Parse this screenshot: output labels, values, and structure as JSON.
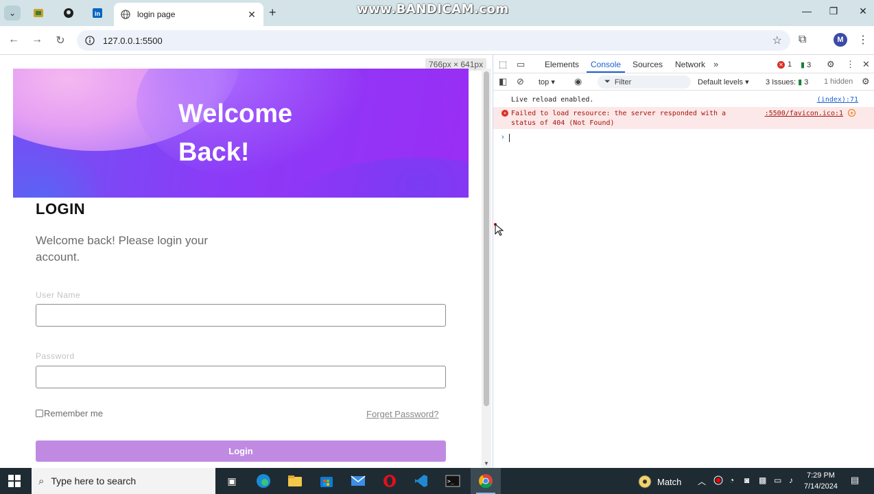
{
  "browser": {
    "tab_title": "login page",
    "url": "127.0.0.1:5500",
    "watermark": "www.BANDICAM.com",
    "profile_initial": "M",
    "viewport_size": "766px × 641px"
  },
  "page": {
    "hero_title": "Welcome Back!",
    "login_heading": "LOGIN",
    "subtitle": "Welcome back! Please login your account.",
    "username_label": "User Name",
    "password_label": "Password",
    "remember_label": "Remember me",
    "forgot_label": "Forget Password?",
    "login_button": "Login",
    "colors": {
      "accent": "#c08ae3",
      "hero_start": "#6e55f3",
      "hero_end": "#9a2df5"
    }
  },
  "devtools": {
    "tabs": [
      "Elements",
      "Console",
      "Sources",
      "Network"
    ],
    "active_tab": "Console",
    "error_count": "1",
    "message_count": "3",
    "context": "top",
    "filter_placeholder": "Filter",
    "levels": "Default levels",
    "issues": "3 Issues:",
    "issues_count": "3",
    "hidden": "1 hidden",
    "log1": {
      "text": "Live reload enabled.",
      "source": "(index):71"
    },
    "log2": {
      "text_line1": "Failed to load resource: the server responded with a",
      "text_line2": "status of 404 (Not Found)",
      "source": ":5500/favicon.ico:1"
    }
  },
  "taskbar": {
    "search_placeholder": "Type here to search",
    "weather_label": "Match",
    "time": "7:29 PM",
    "date": "7/14/2024"
  }
}
